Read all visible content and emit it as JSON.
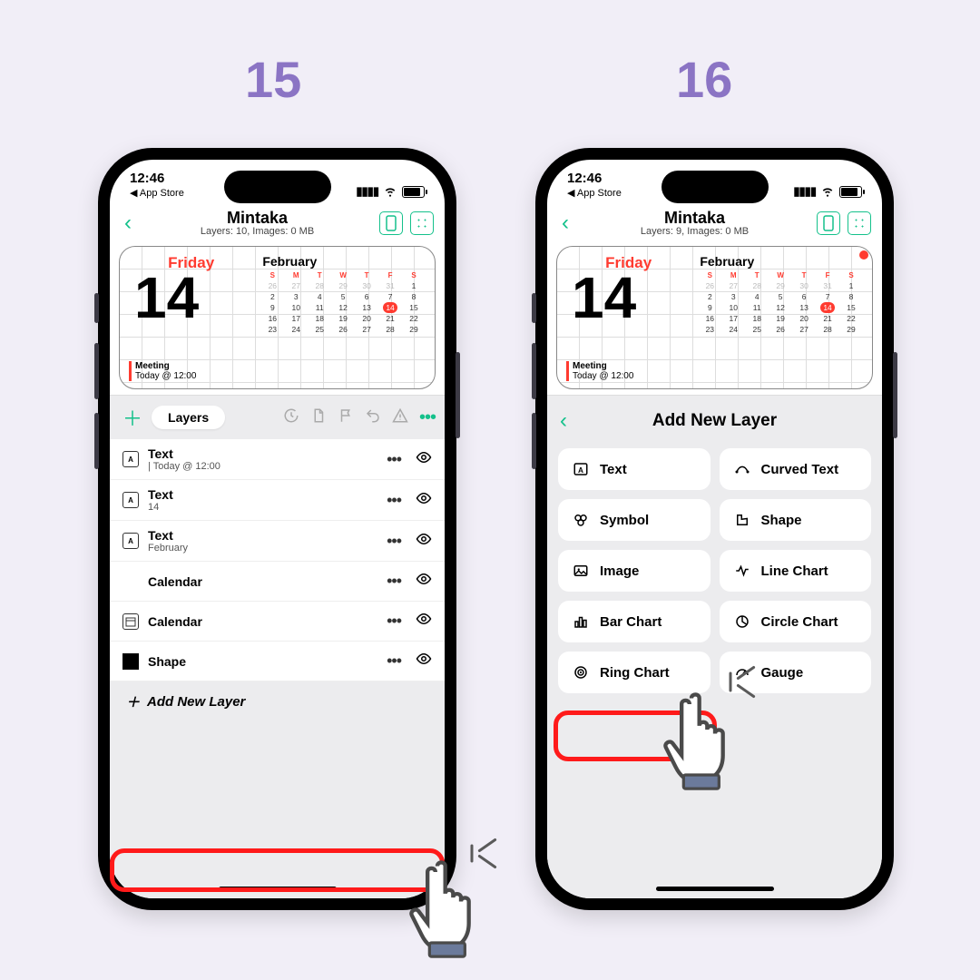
{
  "steps": {
    "s15": "15",
    "s16": "16"
  },
  "status": {
    "time": "12:46",
    "back": "◀ App Store"
  },
  "nav": {
    "title": "Mintaka",
    "sub1": "Layers: 10, Images: 0 MB",
    "sub2": "Layers: 9, Images: 0 MB"
  },
  "widget": {
    "dayname": "Friday",
    "daynum": "14",
    "event_title": "Meeting",
    "event_time": "Today @ 12:00",
    "month": "February",
    "dow": [
      "S",
      "M",
      "T",
      "W",
      "T",
      "F",
      "S"
    ],
    "weeks": [
      [
        "26",
        "27",
        "28",
        "29",
        "30",
        "31",
        "1"
      ],
      [
        "2",
        "3",
        "4",
        "5",
        "6",
        "7",
        "8"
      ],
      [
        "9",
        "10",
        "11",
        "12",
        "13",
        "14",
        "15"
      ],
      [
        "16",
        "17",
        "18",
        "19",
        "20",
        "21",
        "22"
      ],
      [
        "23",
        "24",
        "25",
        "26",
        "27",
        "28",
        "29"
      ]
    ],
    "today": "14"
  },
  "toolbar": {
    "seg": "Layers"
  },
  "layers": [
    {
      "type": "text",
      "name": "Text",
      "sub": "| Today @ 12:00"
    },
    {
      "type": "text",
      "name": "Text",
      "sub": "14"
    },
    {
      "type": "text",
      "name": "Text",
      "sub": "February"
    },
    {
      "type": "none",
      "name": "Calendar",
      "sub": ""
    },
    {
      "type": "cal",
      "name": "Calendar",
      "sub": ""
    },
    {
      "type": "shape",
      "name": "Shape",
      "sub": ""
    }
  ],
  "add_new": "Add New Layer",
  "panel2": {
    "title": "Add New Layer",
    "types": [
      "Text",
      "Curved Text",
      "Symbol",
      "Shape",
      "Image",
      "Line Chart",
      "Bar Chart",
      "Circle Chart",
      "Ring Chart",
      "Gauge"
    ]
  }
}
